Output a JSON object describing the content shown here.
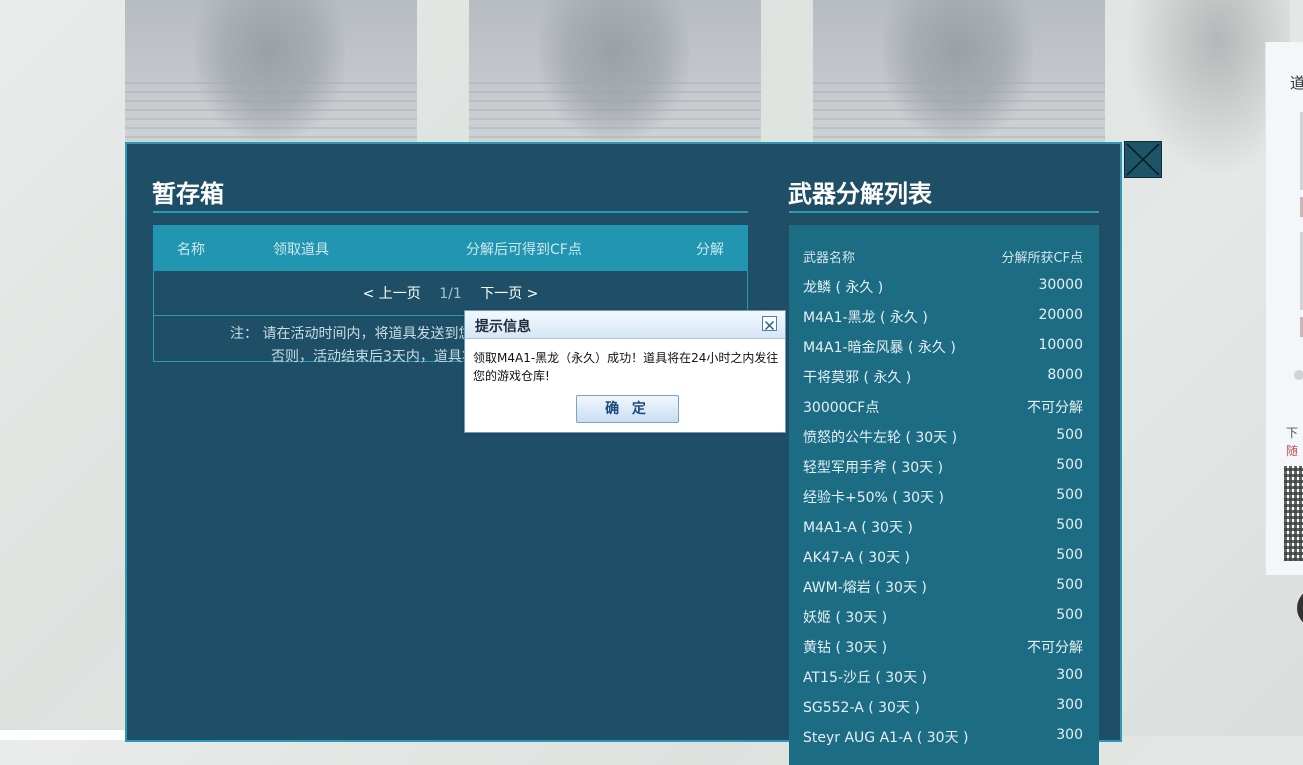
{
  "storage": {
    "title": "暂存箱",
    "columns": [
      "名称",
      "领取道具",
      "分解后可得到CF点",
      "分解"
    ],
    "pager": {
      "prev": "< 上一页",
      "page": "1/1",
      "next": "下一页 >"
    },
    "note_line1": "注： 请在活动时间内，将道具发送到您",
    "note_line2": "否则，活动结束后3天内，道具将"
  },
  "list": {
    "title": "武器分解列表",
    "header": {
      "name": "武器名称",
      "points": "分解所获CF点"
    },
    "items": [
      {
        "name": "龙鳞 ( 永久 )",
        "points": "30000"
      },
      {
        "name": "M4A1-黑龙 ( 永久 )",
        "points": "20000"
      },
      {
        "name": "M4A1-暗金风暴 ( 永久 )",
        "points": "10000"
      },
      {
        "name": "干将莫邪 ( 永久 )",
        "points": "8000"
      },
      {
        "name": "30000CF点",
        "points": "不可分解"
      },
      {
        "name": "愤怒的公牛左轮 ( 30天 )",
        "points": "500"
      },
      {
        "name": "轻型军用手斧 ( 30天 )",
        "points": "500"
      },
      {
        "name": "经验卡+50% ( 30天 )",
        "points": "500"
      },
      {
        "name": "M4A1-A ( 30天 )",
        "points": "500"
      },
      {
        "name": "AK47-A ( 30天 )",
        "points": "500"
      },
      {
        "name": "AWM-熔岩 ( 30天 )",
        "points": "500"
      },
      {
        "name": "妖姬 ( 30天 )",
        "points": "500"
      },
      {
        "name": "黄钻 ( 30天 )",
        "points": "不可分解"
      },
      {
        "name": "AT15-沙丘 ( 30天 )",
        "points": "300"
      },
      {
        "name": "SG552-A ( 30天 )",
        "points": "300"
      },
      {
        "name": "Steyr AUG A1-A ( 30天 )",
        "points": "300"
      }
    ]
  },
  "dialog": {
    "title": "提示信息",
    "message": "领取M4A1-黑龙（永久）成功！道具将在24小时之内发往您的游戏仓库!",
    "ok": "确 定"
  },
  "side": {
    "title": "道",
    "text1": "下",
    "text2": "随"
  },
  "colors": {
    "modal_bg": "#1f4f66",
    "accent": "#2a9bb3",
    "table_header": "#2296b1",
    "list_bg": "#1c6c84"
  }
}
